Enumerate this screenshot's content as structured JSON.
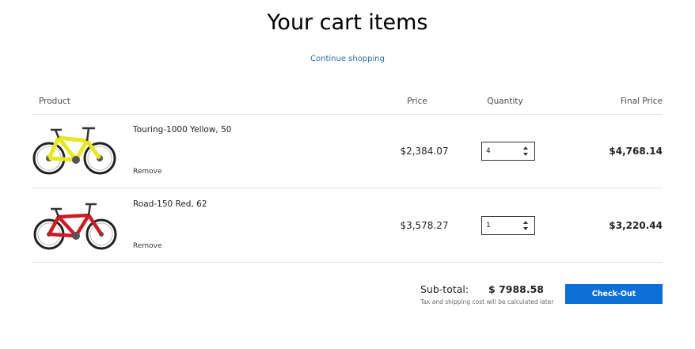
{
  "page": {
    "title": "Your cart items",
    "continue_label": "Continue shopping"
  },
  "table": {
    "headers": {
      "product": "Product",
      "price": "Price",
      "quantity": "Quantity",
      "final_price": "Final Price"
    },
    "rows": [
      {
        "name": "Touring-1000 Yellow, 50",
        "remove_label": "Remove",
        "price": "$2,384.07",
        "quantity": "4",
        "final_price": "$4,768.14",
        "bike_color": "#e8e81e",
        "image_icon": "bike-yellow-icon"
      },
      {
        "name": "Road-150 Red, 62",
        "remove_label": "Remove",
        "price": "$3,578.27",
        "quantity": "1",
        "final_price": "$3,220.44",
        "bike_color": "#cf1a23",
        "image_icon": "bike-red-icon"
      }
    ]
  },
  "summary": {
    "subtotal_label": "Sub-total:",
    "subtotal_value": "$ 7988.58",
    "note": "Tax and shipping cost will be calculated later",
    "checkout_label": "Check-Out"
  },
  "colors": {
    "accent": "#0b6fd6",
    "link": "#2a6fb0",
    "divider": "#e2e2e2"
  }
}
